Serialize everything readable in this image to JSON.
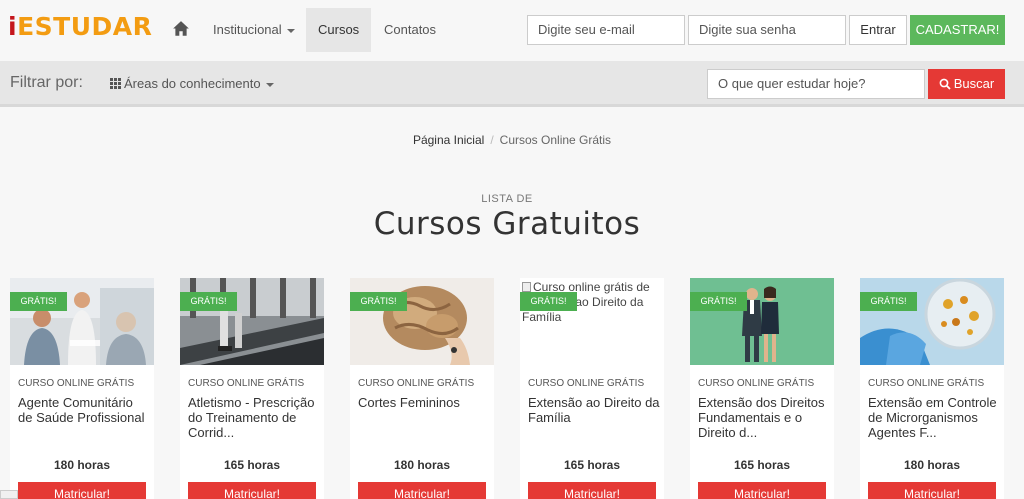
{
  "header": {
    "logo_i": "i",
    "logo_rest": "ESTUDAR",
    "nav": [
      "Institucional",
      "Cursos",
      "Contatos"
    ],
    "email_placeholder": "Digite seu e-mail",
    "password_placeholder": "Digite sua senha",
    "login_label": "Entrar",
    "signup_label": "CADASTRAR!"
  },
  "filter": {
    "label": "Filtrar por:",
    "areas_label": "Áreas do conhecimento",
    "search_placeholder": "O que quer estudar hoje?",
    "search_button": "Buscar"
  },
  "breadcrumb": {
    "home": "Página Inicial",
    "current": "Cursos Online Grátis"
  },
  "heading": {
    "kicker": "LISTA DE",
    "title": "Cursos Gratuitos"
  },
  "courses": [
    {
      "badge": "GRÁTIS!",
      "kicker": "CURSO ONLINE GRÁTIS",
      "title": "Agente Comunitário de Saúde Profissional",
      "hours": "180 horas",
      "button": "Matricular!"
    },
    {
      "badge": "GRÁTIS!",
      "kicker": "CURSO ONLINE GRÁTIS",
      "title": "Atletismo - Prescrição do Treinamento de Corrid...",
      "hours": "165 horas",
      "button": "Matricular!"
    },
    {
      "badge": "GRÁTIS!",
      "kicker": "CURSO ONLINE GRÁTIS",
      "title": "Cortes Femininos",
      "hours": "180 horas",
      "button": "Matricular!"
    },
    {
      "badge": "GRÁTIS!",
      "kicker": "CURSO ONLINE GRÁTIS",
      "title": "Extensão ao Direito da Família",
      "hours": "165 horas",
      "button": "Matricular!",
      "image_alt": "Curso online grátis de Extensão ao Direito da Família"
    },
    {
      "badge": "GRÁTIS!",
      "kicker": "CURSO ONLINE GRÁTIS",
      "title": "Extensão dos Direitos Fundamentais e o Direito d...",
      "hours": "165 horas",
      "button": "Matricular!"
    },
    {
      "badge": "GRÁTIS!",
      "kicker": "CURSO ONLINE GRÁTIS",
      "title": "Extensão em Controle de Microrganismos Agentes F...",
      "hours": "180 horas",
      "button": "Matricular!"
    }
  ],
  "colors": {
    "brand_red": "#c4161c",
    "brand_orange": "#f39c12",
    "green": "#5cb85c",
    "danger": "#e53935"
  }
}
